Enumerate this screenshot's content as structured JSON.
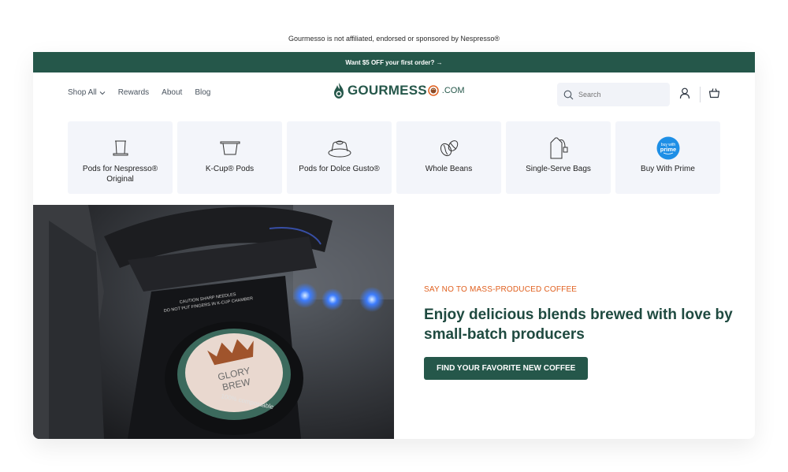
{
  "disclaimer": "Gourmesso is not affiliated, endorsed or sponsored by Nespresso®",
  "promo": "Want $5 OFF your first order? →",
  "nav": {
    "shop_all": "Shop All",
    "rewards": "Rewards",
    "about": "About",
    "blog": "Blog"
  },
  "logo": {
    "word": "GOURMESS",
    "suffix": ".COM"
  },
  "search": {
    "placeholder": "Search"
  },
  "categories": [
    {
      "label": "Pods for Nespresso® Original",
      "icon": "nespresso-pod-icon"
    },
    {
      "label": "K-Cup® Pods",
      "icon": "k-cup-icon"
    },
    {
      "label": "Pods for Dolce Gusto®",
      "icon": "dolce-gusto-pod-icon"
    },
    {
      "label": "Whole Beans",
      "icon": "coffee-beans-icon"
    },
    {
      "label": "Single-Serve Bags",
      "icon": "tea-bag-icon"
    },
    {
      "label": "Buy With Prime",
      "icon": "prime-badge-icon",
      "badge_line1": "buy with",
      "badge_line2": "prime"
    }
  ],
  "hero": {
    "eyebrow": "SAY NO TO MASS-PRODUCED COFFEE",
    "headline": "Enjoy delicious blends brewed with love by small-batch producers",
    "cta": "FIND YOUR FAVORITE NEW COFFEE",
    "image_text": {
      "warning1": "CAUTION SHARP NEEDLES",
      "warning2": "DO NOT PUT FINGERS IN K-CUP CHAMBER",
      "pod_brand1": "GLORY",
      "pod_brand2": "BREW",
      "pod_note": "100% compostable"
    }
  },
  "colors": {
    "brand": "#25574a",
    "accent": "#e0601f",
    "card": "#f3f5fa"
  }
}
